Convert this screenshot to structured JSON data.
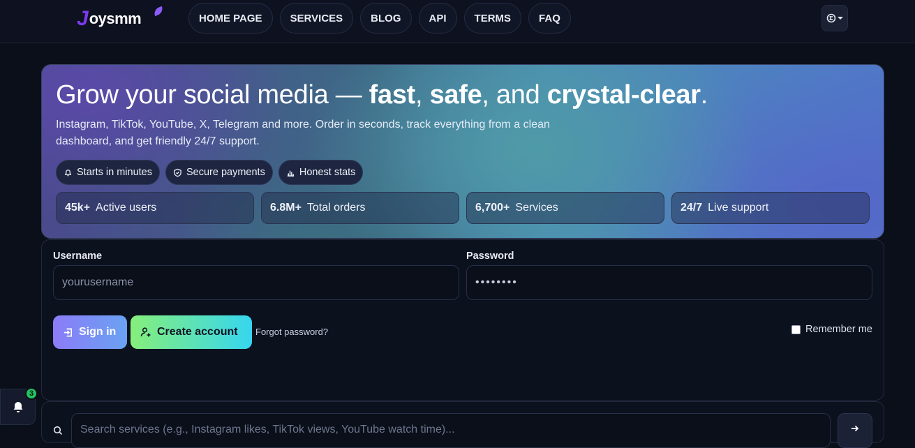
{
  "brand": {
    "logo_first": "J",
    "logo_rest": "oysmm"
  },
  "nav": {
    "links": [
      "HOME PAGE",
      "SERVICES",
      "BLOG",
      "API",
      "TERMS",
      "FAQ"
    ],
    "lang_icon": "globe-icon"
  },
  "hero": {
    "title_1": "Grow your social media — ",
    "title_fast": "fast",
    "title_2": ", ",
    "title_safe": "safe",
    "title_3": ", and ",
    "title_clear": "crystal-clear",
    "title_4": ".",
    "subtitle": "Instagram, TikTok, YouTube, X, Telegram and more. Order in seconds, track everything from a clean dashboard, and get friendly 24/7 support.",
    "chips": [
      {
        "icon": "bell-icon",
        "label": "Starts in minutes"
      },
      {
        "icon": "shield-check-icon",
        "label": "Secure payments"
      },
      {
        "icon": "bar-chart-icon",
        "label": "Honest stats"
      }
    ],
    "stats": [
      {
        "value": "45k+",
        "label": "Active users"
      },
      {
        "value": "6.8M+",
        "label": "Total orders"
      },
      {
        "value": "6,700+",
        "label": "Services"
      },
      {
        "value": "24/7",
        "label": "Live support"
      }
    ]
  },
  "login": {
    "username_label": "Username",
    "username_placeholder": "yourusername",
    "password_label": "Password",
    "password_value": "••••••••",
    "signin_label": "Sign in",
    "create_label": "Create account",
    "forgot_label": "Forgot password?",
    "remember_label": "Remember me"
  },
  "search": {
    "placeholder": "Search services (e.g., Instagram likes, TikTok views, YouTube watch time)..."
  },
  "notifications": {
    "count": "3"
  },
  "colors": {
    "page_bg": "#0b0f1a",
    "accent_purple": "#7c3aed",
    "signin_gradient": [
      "#8b7cf8",
      "#6aa2f2"
    ],
    "create_gradient": [
      "#86ef7a",
      "#36d6f0"
    ],
    "badge_green": "#22c55e"
  }
}
